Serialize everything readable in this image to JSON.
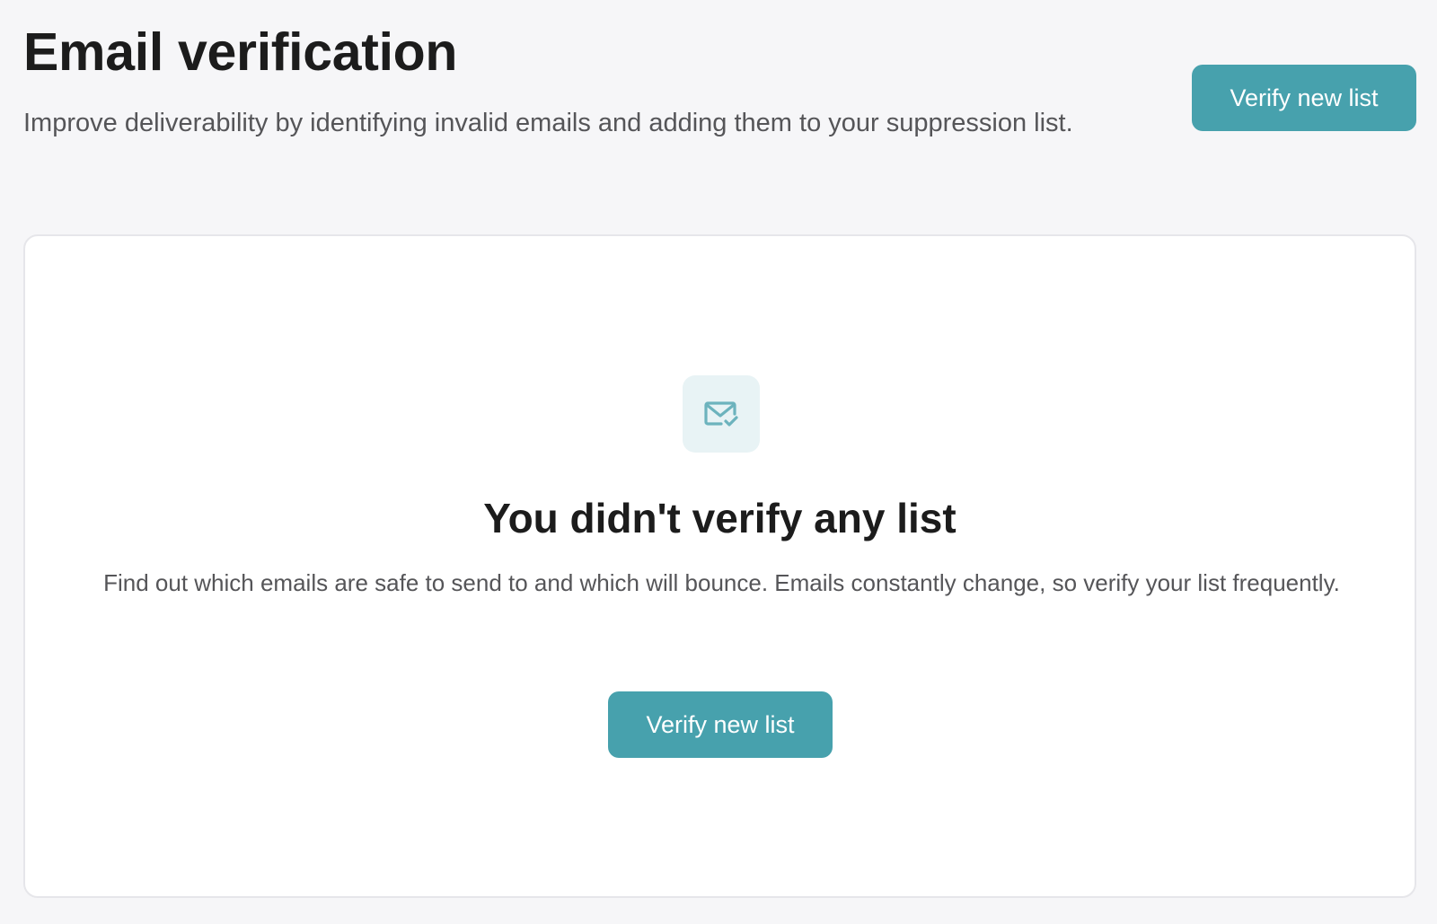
{
  "header": {
    "title": "Email verification",
    "subtitle": "Improve deliverability by identifying invalid emails and adding them to your suppression list.",
    "verify_button_label": "Verify new list"
  },
  "empty_state": {
    "icon": "mail-check-icon",
    "title": "You didn't verify any list",
    "description": "Find out which emails are safe to send to and which will bounce. Emails constantly change, so verify your list frequently.",
    "verify_button_label": "Verify new list"
  },
  "colors": {
    "accent": "#47a1ad",
    "icon_background": "#e8f3f5",
    "page_background": "#f6f6f8"
  }
}
